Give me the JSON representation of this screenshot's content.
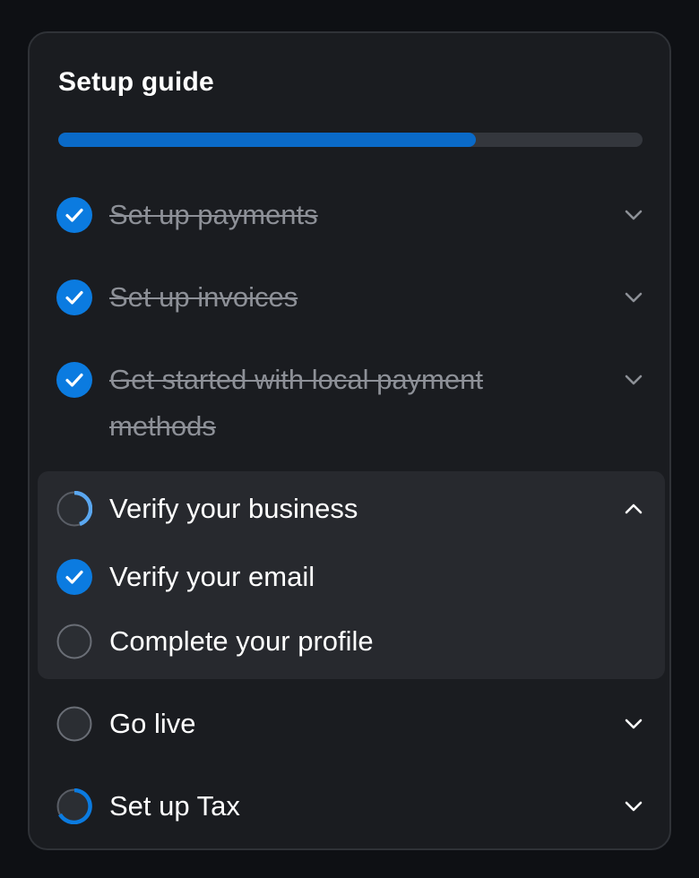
{
  "setup_guide": {
    "title": "Setup guide",
    "progress_fraction": 0.714,
    "colors": {
      "accent": "#0a6ac8",
      "check": "#0b7be0",
      "progress_track": "#34373d",
      "muted_text": "#8d9097"
    },
    "items": [
      {
        "label": "Set up payments",
        "status": "complete",
        "expanded": false,
        "chevron": "chevron-down-icon"
      },
      {
        "label": "Set up invoices",
        "status": "complete",
        "expanded": false,
        "chevron": "chevron-down-icon"
      },
      {
        "label": "Get started with local payment methods",
        "status": "complete",
        "expanded": false,
        "chevron": "chevron-down-icon"
      },
      {
        "label": "Verify your business",
        "status": "in-progress",
        "expanded": true,
        "chevron": "chevron-up-icon",
        "subitems": [
          {
            "label": "Verify your email",
            "status": "complete"
          },
          {
            "label": "Complete your profile",
            "status": "incomplete"
          }
        ]
      },
      {
        "label": "Go live",
        "status": "incomplete",
        "expanded": false,
        "chevron": "chevron-down-icon"
      },
      {
        "label": "Set up Tax",
        "status": "in-progress",
        "expanded": false,
        "chevron": "chevron-down-icon"
      }
    ]
  }
}
